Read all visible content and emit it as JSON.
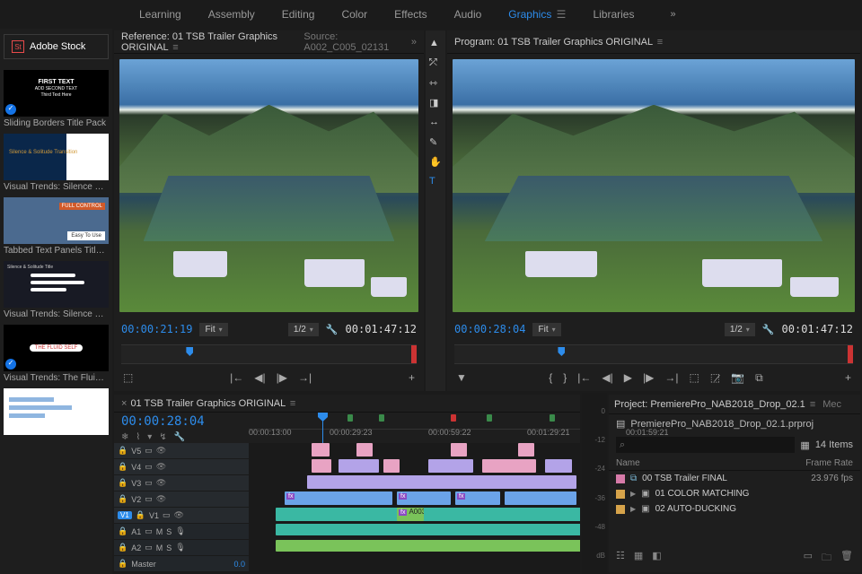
{
  "workspaces": {
    "items": [
      "Learning",
      "Assembly",
      "Editing",
      "Color",
      "Effects",
      "Audio",
      "Graphics",
      "Libraries"
    ],
    "active": "Graphics"
  },
  "left": {
    "stock_label": "Adobe Stock",
    "templates": [
      {
        "title": "Sliding Borders Title Pack",
        "thumb_text1": "FIRST TEXT",
        "thumb_text2": "ADD SECOND TEXT",
        "thumb_text3": "Third Text Here"
      },
      {
        "title": "Visual Trends: Silence &…",
        "thumb_text": "Silence & Solitude Transition"
      },
      {
        "title": "Tabbed Text Panels Title…",
        "thumb_text": "Easy To Use",
        "thumb_text2": "FULL CONTROL"
      },
      {
        "title": "Visual Trends: Silence &…",
        "thumb_text": "Silence & Solitude Title"
      },
      {
        "title": "Visual Trends: The Fluid …",
        "thumb_text": "THE FLUID SELF"
      },
      {
        "title": ""
      }
    ]
  },
  "reference": {
    "tab_a": "Reference: 01 TSB Trailer Graphics ORIGINAL",
    "tab_b": "Source: A002_C005_02131",
    "tc_in": "00:00:21:19",
    "fit": "Fit",
    "res": "1/2",
    "tc_out": "00:01:47:12"
  },
  "program": {
    "tab": "Program: 01 TSB Trailer Graphics ORIGINAL",
    "tc_in": "00:00:28:04",
    "fit": "Fit",
    "res": "1/2",
    "tc_out": "00:01:47:12"
  },
  "timeline": {
    "title": "01 TSB Trailer Graphics ORIGINAL",
    "tc": "00:00:28:04",
    "ruler": [
      "00:00:13:00",
      "00:00:29:23",
      "00:00:59:22",
      "00:01:29:21",
      "00:01:59:21"
    ],
    "vtracks": [
      "V5",
      "V4",
      "V3",
      "V2",
      "V1"
    ],
    "atracks": [
      "A1",
      "A2"
    ],
    "target": "V1",
    "master": "Master",
    "master_val": "0.0",
    "clip_label": "A003"
  },
  "audio_meter": [
    "0",
    "-12",
    "-24",
    "-36",
    "-48",
    "dB"
  ],
  "project": {
    "tab": "Project: PremierePro_NAB2018_Drop_02.1",
    "tab2": "Mec",
    "file": "PremierePro_NAB2018_Drop_02.1.prproj",
    "count": "14 Items",
    "hdr_name": "Name",
    "hdr_fr": "Frame Rate",
    "items": [
      {
        "color": "pink",
        "icon": "seq",
        "name": "00 TSB Trailer FINAL",
        "fr": "23.976 fps"
      },
      {
        "color": "org",
        "icon": "bin",
        "name": "01 COLOR MATCHING",
        "fr": ""
      },
      {
        "color": "org",
        "icon": "bin",
        "name": "02 AUTO-DUCKING",
        "fr": ""
      }
    ]
  },
  "tools": [
    "select",
    "track-select",
    "ripple",
    "rolling",
    "rate",
    "pen",
    "hand",
    "type"
  ]
}
